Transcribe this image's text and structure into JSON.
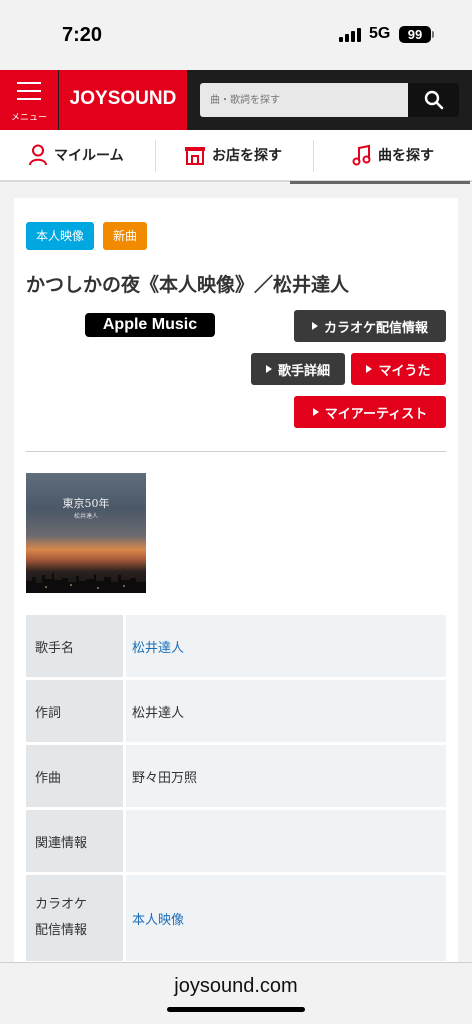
{
  "status_bar": {
    "time": "7:20",
    "network": "5G",
    "battery": "99"
  },
  "header": {
    "menu_label": "メニュー",
    "logo": "JOYSOUND",
    "search_placeholder": "曲・歌詞を探す",
    "brand_color": "#e2001a"
  },
  "nav": {
    "items": [
      {
        "label": "マイルーム",
        "icon": "person-icon"
      },
      {
        "label": "お店を探す",
        "icon": "store-icon"
      },
      {
        "label": "曲を探す",
        "icon": "music-note-icon"
      }
    ]
  },
  "song": {
    "badges": [
      "本人映像",
      "新曲"
    ],
    "title": "かつしかの夜《本人映像》／松井達人",
    "apple_music": "Apple Music",
    "buttons": {
      "karaoke_info": "カラオケ配信情報",
      "artist_detail": "歌手詳細",
      "my_uta": "マイうた",
      "my_artist": "マイアーティスト"
    },
    "jacket": {
      "title": "東京50年",
      "artist": "松井達人"
    }
  },
  "info_table": [
    {
      "label": "歌手名",
      "value": "松井達人",
      "link": true
    },
    {
      "label": "作詞",
      "value": "松井達人",
      "link": false
    },
    {
      "label": "作曲",
      "value": "野々田万照",
      "link": false
    },
    {
      "label": "関連情報",
      "value": "",
      "link": false
    },
    {
      "label_line1": "カラオケ",
      "label_line2": "配信情報",
      "value": "本人映像",
      "link": true
    }
  ],
  "browser": {
    "url": "joysound.com"
  }
}
